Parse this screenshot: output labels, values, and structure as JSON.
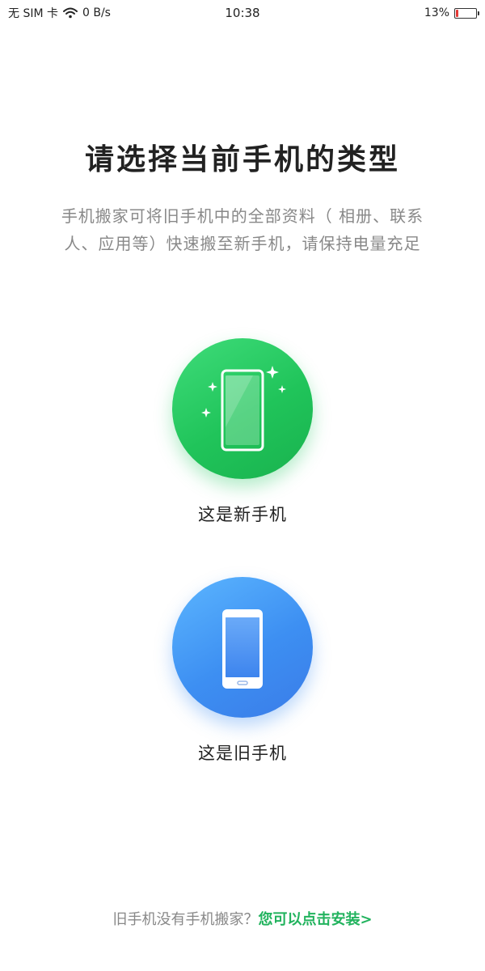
{
  "status_bar": {
    "sim_text": "无 SIM 卡",
    "network_speed": "0 B/s",
    "time": "10:38",
    "battery_percent_text": "13%",
    "battery_level": 0.13,
    "battery_color": "#e53935"
  },
  "page": {
    "title": "请选择当前手机的类型",
    "description_line1": "手机搬家可将旧手机中的全部资料（ 相册、联系",
    "description_line2": "人、应用等）快速搬至新手机，请保持电量充足"
  },
  "options": {
    "new_phone": {
      "label": "这是新手机",
      "icon": "new-phone-sparkle-icon",
      "color": "#20c45a"
    },
    "old_phone": {
      "label": "这是旧手机",
      "icon": "old-phone-icon",
      "color": "#3d8ff2"
    }
  },
  "footer": {
    "prompt": "旧手机没有手机搬家？",
    "link": "您可以点击安装>",
    "link_color": "#22b35e"
  }
}
